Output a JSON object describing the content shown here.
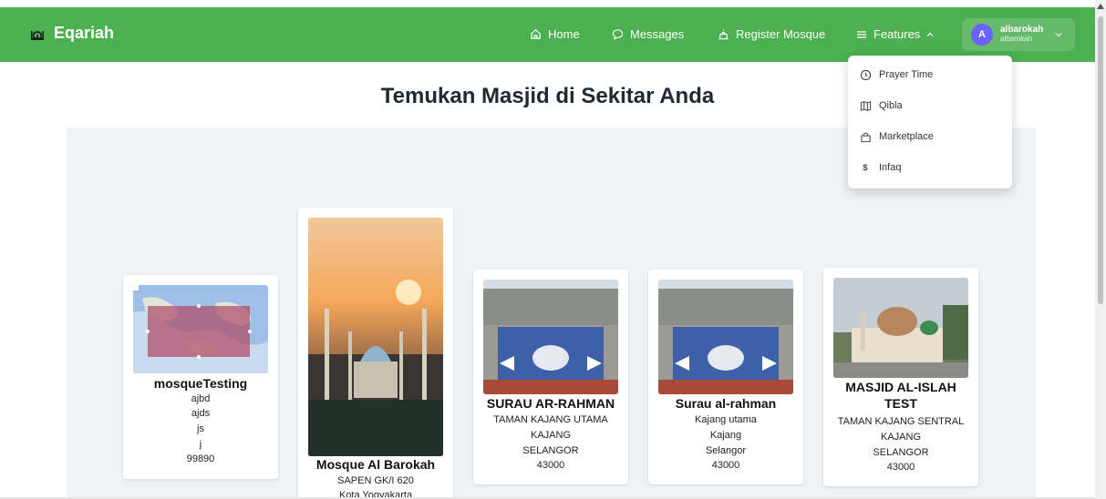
{
  "brand": {
    "name": "Eqariah",
    "icon": "mosque-icon"
  },
  "nav": {
    "home": "Home",
    "messages": "Messages",
    "register": "Register Mosque",
    "features": "Features"
  },
  "user": {
    "initial": "A",
    "name": "albarokah",
    "handle": "albarokah"
  },
  "page": {
    "title": "Temukan Masjid di Sekitar Anda"
  },
  "features_menu": [
    {
      "label": "Prayer Time",
      "icon": "clock-icon"
    },
    {
      "label": "Qibla",
      "icon": "map-icon"
    },
    {
      "label": "Marketplace",
      "icon": "shopping-bag-icon"
    },
    {
      "label": "Infaq",
      "icon": "dollar-icon"
    }
  ],
  "mosques": [
    {
      "name": "mosqueTesting",
      "lines": [
        "ajbd",
        "ajds",
        "js",
        "j",
        "99890"
      ]
    },
    {
      "name": "Mosque Al Barokah",
      "lines": [
        "SAPEN GK/I 620",
        "Kota Yogyakarta"
      ]
    },
    {
      "name": "SURAU AR-RAHMAN",
      "lines": [
        "TAMAN KAJANG UTAMA",
        "KAJANG",
        "SELANGOR",
        "43000"
      ]
    },
    {
      "name": "Surau al-rahman",
      "lines": [
        "Kajang utama",
        "Kajang",
        "Selangor",
        "43000"
      ]
    },
    {
      "name_1": "MASJID AL-ISLAH",
      "name_2": "TEST",
      "lines": [
        "TAMAN KAJANG SENTRAL",
        "KAJANG",
        "SELANGOR",
        "43000"
      ]
    }
  ],
  "colors": {
    "nav": "#4caf50",
    "avatar": "#6c63ff",
    "panel": "#f0f2f6"
  }
}
